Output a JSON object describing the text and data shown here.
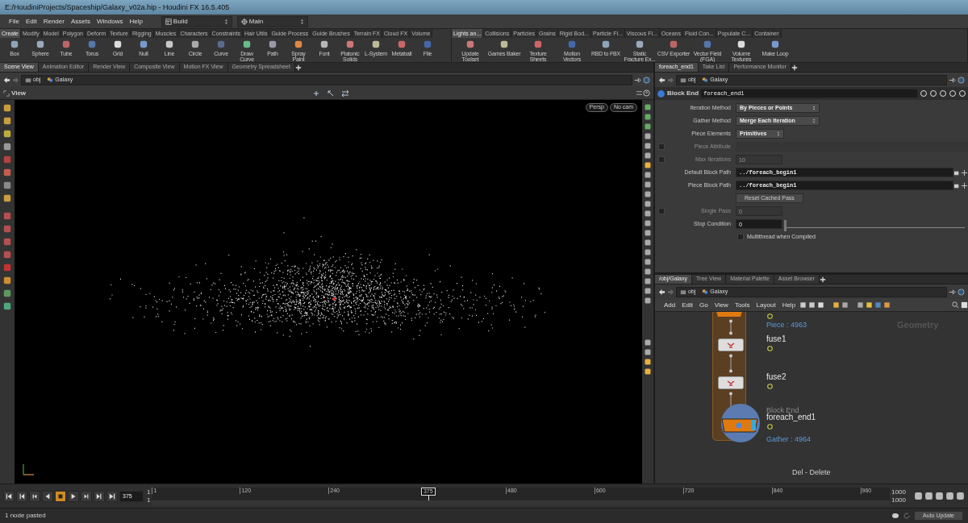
{
  "window": {
    "title": "E:/HoudiniProjects/Spaceship/Galaxy_v02a.hip - Houdini FX 16.5.405"
  },
  "menu": [
    "File",
    "Edit",
    "Render",
    "Assets",
    "Windows",
    "Help"
  ],
  "desk_selectors": [
    {
      "kind": "desktop",
      "value": "Build"
    },
    {
      "kind": "context",
      "value": "Main"
    }
  ],
  "shelves": [
    {
      "tabs": [
        {
          "label": "Create",
          "selected": true
        },
        {
          "label": "Modify",
          "selected": false
        },
        {
          "label": "Model",
          "selected": false
        },
        {
          "label": "Polygon",
          "selected": false
        },
        {
          "label": "Deform",
          "selected": false
        },
        {
          "label": "Texture",
          "selected": false
        },
        {
          "label": "Rigging",
          "selected": false
        },
        {
          "label": "Muscles",
          "selected": false
        },
        {
          "label": "Characters",
          "selected": false
        },
        {
          "label": "Constraints",
          "selected": false
        },
        {
          "label": "Hair Utils",
          "selected": false
        },
        {
          "label": "Guide Process",
          "selected": false
        },
        {
          "label": "Guide Brushes",
          "selected": false
        },
        {
          "label": "Terrain FX",
          "selected": false
        },
        {
          "label": "Cloud FX",
          "selected": false
        },
        {
          "label": "Volume",
          "selected": false
        }
      ],
      "tools": [
        "Box",
        "Sphere",
        "Tube",
        "Torus",
        "Grid",
        "Null",
        "Line",
        "Circle",
        "Curve",
        "Draw Curve",
        "Path",
        "Spray Paint",
        "Font",
        "Platonic Solids",
        "L-System",
        "Metaball",
        "File"
      ]
    },
    {
      "tabs": [
        {
          "label": "Lights an...",
          "selected": true
        },
        {
          "label": "Collisions",
          "selected": false
        },
        {
          "label": "Particles",
          "selected": false
        },
        {
          "label": "Grains",
          "selected": false
        },
        {
          "label": "Rigid Bod...",
          "selected": false
        },
        {
          "label": "Particle Fl...",
          "selected": false
        },
        {
          "label": "Viscous Fl...",
          "selected": false
        },
        {
          "label": "Oceans",
          "selected": false
        },
        {
          "label": "Fluid Con...",
          "selected": false
        },
        {
          "label": "Populate C...",
          "selected": false
        },
        {
          "label": "Container",
          "selected": false
        }
      ],
      "tools": [
        "Update Toolset",
        "Games Baker",
        "Texture Sheets",
        "Motion Vectors",
        "RBD to FBX",
        "Static Fracture Ex...",
        "CSV Exporter",
        "Vector Field (FGA)",
        "Volume Textures",
        "Make Loop"
      ]
    }
  ],
  "scene_pane": {
    "tabs": [
      {
        "label": "Scene View",
        "selected": true
      },
      {
        "label": "Animation Editor",
        "selected": false
      },
      {
        "label": "Render View",
        "selected": false
      },
      {
        "label": "Composite View",
        "selected": false
      },
      {
        "label": "Motion FX View",
        "selected": false
      },
      {
        "label": "Geometry Spreadsheet",
        "selected": false
      }
    ],
    "path": [
      "obj",
      "Galaxy"
    ],
    "view_title": "View",
    "camera_menus": [
      "Persp",
      "No cam"
    ]
  },
  "parameter_pane": {
    "tabs": [
      {
        "label": "foreach_end1",
        "selected": true
      },
      {
        "label": "Take List",
        "selected": false
      },
      {
        "label": "Performance Monitor",
        "selected": false
      }
    ],
    "path": [
      "obj",
      "Galaxy"
    ],
    "node_type": "Block End",
    "node_name": "foreach_end1",
    "parameters": [
      {
        "kind": "menu",
        "label": "Iteration Method",
        "value": "By Pieces or Points",
        "disabled": false
      },
      {
        "kind": "menu",
        "label": "Gather Method",
        "value": "Merge Each Iteration",
        "disabled": false
      },
      {
        "kind": "menu",
        "label": "Piece Elements",
        "value": "Primitives",
        "disabled": false
      },
      {
        "kind": "text",
        "label": "Piece Attribute",
        "toggled": false,
        "disabled": true
      },
      {
        "kind": "number",
        "label": "Max Iterations",
        "value": "10",
        "toggled": false,
        "disabled": true
      },
      {
        "kind": "path",
        "label": "Default Block Path",
        "value": "../foreach_begin1",
        "disabled": false
      },
      {
        "kind": "path",
        "label": "Piece Block Path",
        "value": "../foreach_begin1",
        "disabled": false
      },
      {
        "kind": "button",
        "value": "Reset Cached Pass",
        "disabled": false
      },
      {
        "kind": "number",
        "label": "Single Pass",
        "value": "0",
        "toggled": false,
        "disabled": true
      },
      {
        "kind": "slider",
        "label": "Stop Condition",
        "value": "0",
        "level": 0,
        "disabled": false
      },
      {
        "kind": "checkbox",
        "label": "Multithread when Compiled",
        "checked": false,
        "disabled": false
      }
    ]
  },
  "network_pane": {
    "tabs": [
      {
        "label": "/obj/Galaxy",
        "selected": true
      },
      {
        "label": "Tree View",
        "selected": false
      },
      {
        "label": "Material Palette",
        "selected": false
      },
      {
        "label": "Asset Browser",
        "selected": false
      }
    ],
    "path": [
      "obj",
      "Galaxy"
    ],
    "menu": [
      "Add",
      "Edit",
      "Go",
      "View",
      "Tools",
      "Layout",
      "Help"
    ],
    "context_label": "Geometry",
    "nodes": [
      {
        "kind": "block_begin",
        "info": "Piece : 4963",
        "selected": false
      },
      {
        "kind": "fuse",
        "name": "fuse1",
        "selected": false
      },
      {
        "kind": "fuse",
        "name": "fuse2",
        "selected": false
      },
      {
        "kind": "block_end",
        "type_label": "Block End",
        "name": "foreach_end1",
        "info": "Gather : 4964",
        "selected": true
      }
    ],
    "hint": "Del - Delete"
  },
  "timeline": {
    "transport": [
      {
        "kind": "start",
        "selected": false
      },
      {
        "kind": "prev_key",
        "selected": false
      },
      {
        "kind": "prev_frame",
        "selected": false
      },
      {
        "kind": "reverse",
        "selected": false
      },
      {
        "kind": "stop",
        "selected": true
      },
      {
        "kind": "play",
        "selected": false
      },
      {
        "kind": "next_frame",
        "selected": false
      },
      {
        "kind": "next_key",
        "selected": false
      },
      {
        "kind": "end",
        "selected": false
      }
    ],
    "frame": "375",
    "start": "1",
    "start_2": "1",
    "end": "1000",
    "end_2": "1000",
    "current_label": "375",
    "level": 0.3744,
    "ticks": [
      "1",
      "120",
      "240",
      "480",
      "600",
      "720",
      "840",
      "960"
    ]
  },
  "status_bar": {
    "message": "1 node pasted",
    "update_mode": "Auto Update"
  }
}
